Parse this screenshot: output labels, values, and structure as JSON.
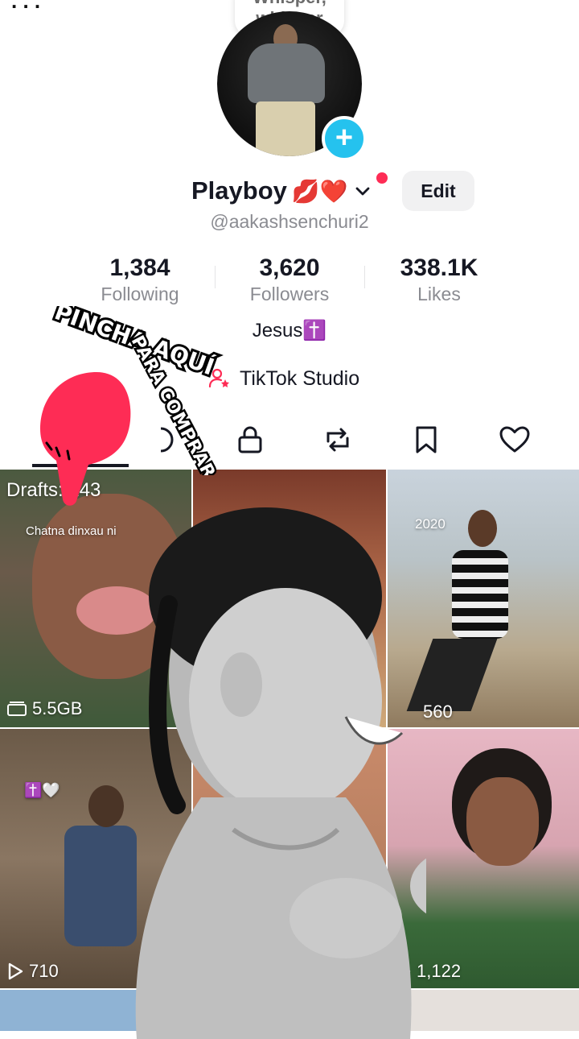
{
  "profile": {
    "note": "Whisper, whisper",
    "name": "Playboy",
    "name_emojis": "💋❤️",
    "handle": "@aakashsenchuri2",
    "edit_label": "Edit",
    "bio": "Jesus✝️",
    "studio_label": "TikTok Studio"
  },
  "stats": [
    {
      "value": "1,384",
      "label": "Following"
    },
    {
      "value": "3,620",
      "label": "Followers"
    },
    {
      "value": "338.1K",
      "label": "Likes"
    }
  ],
  "tabs": [
    {
      "icon": "grid-icon"
    },
    {
      "icon": "lock-icon"
    },
    {
      "icon": "repost-icon"
    },
    {
      "icon": "bookmark-icon"
    },
    {
      "icon": "heart-icon"
    }
  ],
  "videos": [
    {
      "badge": "Drafts: 243",
      "caption": "Chatna dinxau ni",
      "meta": "5.5GB"
    },
    {
      "year": "2020",
      "meta": "560"
    },
    {
      "caption_emoji": "✝️🤍",
      "meta": "710"
    },
    {
      "meta": "1,122"
    }
  ],
  "promo": {
    "line1": "PINCHA AQUÍ",
    "line2": "PARA COMPRAR"
  },
  "colors": {
    "accent": "#fe2c55",
    "add_button": "#25c2ee",
    "text_primary": "#161823",
    "text_secondary": "#8a8b91"
  }
}
